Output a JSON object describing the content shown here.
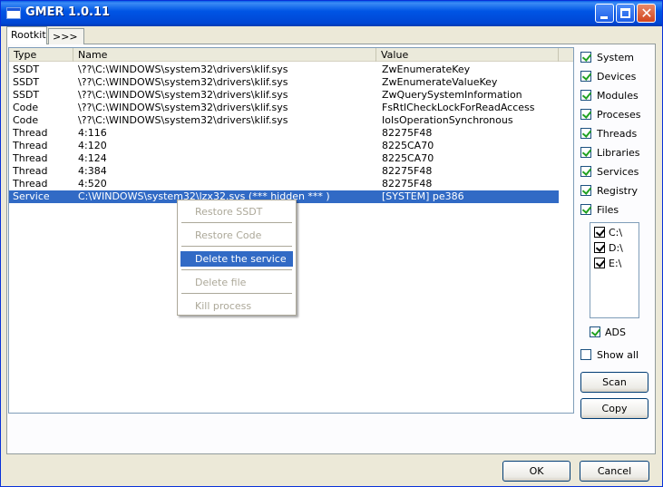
{
  "window": {
    "title": "GMER 1.0.11"
  },
  "tabs": [
    {
      "label": "Rootkit"
    },
    {
      "label": ">>>"
    }
  ],
  "list": {
    "columns": [
      "Type",
      "Name",
      "Value"
    ],
    "rows": [
      {
        "type": "SSDT",
        "name": "\\??\\C:\\WINDOWS\\system32\\drivers\\klif.sys",
        "value": "ZwEnumerateKey"
      },
      {
        "type": "SSDT",
        "name": "\\??\\C:\\WINDOWS\\system32\\drivers\\klif.sys",
        "value": "ZwEnumerateValueKey"
      },
      {
        "type": "SSDT",
        "name": "\\??\\C:\\WINDOWS\\system32\\drivers\\klif.sys",
        "value": "ZwQuerySystemInformation"
      },
      {
        "type": "Code",
        "name": "\\??\\C:\\WINDOWS\\system32\\drivers\\klif.sys",
        "value": "FsRtlCheckLockForReadAccess"
      },
      {
        "type": "Code",
        "name": "\\??\\C:\\WINDOWS\\system32\\drivers\\klif.sys",
        "value": "IoIsOperationSynchronous"
      },
      {
        "type": "Thread",
        "name": "4:116",
        "value": "82275F48"
      },
      {
        "type": "Thread",
        "name": "4:120",
        "value": "8225CA70"
      },
      {
        "type": "Thread",
        "name": "4:124",
        "value": "8225CA70"
      },
      {
        "type": "Thread",
        "name": "4:384",
        "value": "82275F48"
      },
      {
        "type": "Thread",
        "name": "4:520",
        "value": "82275F48"
      },
      {
        "type": "Service",
        "name": "C:\\WINDOWS\\system32\\lzx32.sys (*** hidden *** )",
        "value": "[SYSTEM] pe386",
        "selected": true
      }
    ]
  },
  "context_menu": {
    "items": [
      {
        "label": "Restore SSDT",
        "enabled": false
      },
      {
        "label": "Restore Code",
        "enabled": false
      },
      {
        "label": "Delete the service",
        "enabled": true
      },
      {
        "label": "Delete file",
        "enabled": false
      },
      {
        "label": "Kill process",
        "enabled": false
      }
    ]
  },
  "options": [
    {
      "label": "System",
      "checked": true
    },
    {
      "label": "Devices",
      "checked": true
    },
    {
      "label": "Modules",
      "checked": true
    },
    {
      "label": "Proceses",
      "checked": true
    },
    {
      "label": "Threads",
      "checked": true
    },
    {
      "label": "Libraries",
      "checked": true
    },
    {
      "label": "Services",
      "checked": true
    },
    {
      "label": "Registry",
      "checked": true
    },
    {
      "label": "Files",
      "checked": true
    }
  ],
  "drives": [
    {
      "label": "C:\\",
      "checked": true
    },
    {
      "label": "D:\\",
      "checked": true
    },
    {
      "label": "E:\\",
      "checked": true
    }
  ],
  "ads": {
    "label": "ADS",
    "checked": true
  },
  "show_all": {
    "label": "Show all",
    "checked": false
  },
  "buttons": {
    "scan": "Scan",
    "copy": "Copy",
    "ok": "OK",
    "cancel": "Cancel"
  },
  "colors": {
    "selection": "#316ac5",
    "titlebar": "#0055e5",
    "window_bg": "#ece9d8"
  }
}
